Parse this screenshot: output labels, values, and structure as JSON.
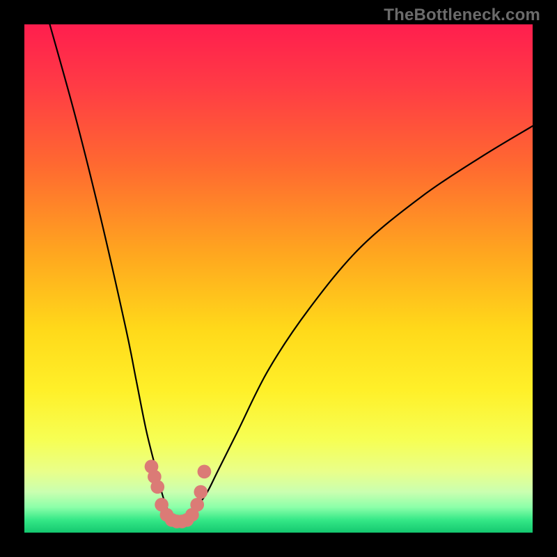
{
  "watermark": "TheBottleneck.com",
  "chart_data": {
    "type": "line",
    "title": "",
    "xlabel": "",
    "ylabel": "",
    "xlim": [
      0,
      100
    ],
    "ylim": [
      0,
      100
    ],
    "series": [
      {
        "name": "bottleneck-curve",
        "x": [
          5,
          10,
          15,
          20,
          22,
          24,
          26,
          27,
          28,
          29,
          30,
          31,
          32,
          33,
          34,
          36,
          38,
          42,
          48,
          56,
          66,
          78,
          90,
          100
        ],
        "y": [
          100,
          82,
          62,
          40,
          30,
          20,
          12,
          8,
          5,
          3,
          2,
          2,
          2,
          3,
          5,
          8,
          12,
          20,
          32,
          44,
          56,
          66,
          74,
          80
        ]
      }
    ],
    "markers": {
      "name": "highlight-dots",
      "color": "#db7b76",
      "x": [
        25.0,
        25.6,
        26.2,
        27.0,
        28.0,
        29.0,
        30.0,
        31.0,
        32.0,
        33.0,
        34.0,
        34.7,
        35.4
      ],
      "y": [
        13.0,
        11.0,
        9.0,
        5.5,
        3.5,
        2.5,
        2.2,
        2.2,
        2.5,
        3.5,
        5.5,
        8.0,
        12.0
      ]
    },
    "background_gradient": {
      "stops": [
        {
          "offset": 0.0,
          "color": "#ff1e4e"
        },
        {
          "offset": 0.12,
          "color": "#ff3b45"
        },
        {
          "offset": 0.28,
          "color": "#ff6a30"
        },
        {
          "offset": 0.45,
          "color": "#ffa61f"
        },
        {
          "offset": 0.6,
          "color": "#ffd91a"
        },
        {
          "offset": 0.72,
          "color": "#fff029"
        },
        {
          "offset": 0.82,
          "color": "#f6ff55"
        },
        {
          "offset": 0.88,
          "color": "#e9ff8a"
        },
        {
          "offset": 0.92,
          "color": "#caffb0"
        },
        {
          "offset": 0.95,
          "color": "#8cffa9"
        },
        {
          "offset": 0.975,
          "color": "#35e887"
        },
        {
          "offset": 1.0,
          "color": "#14c86f"
        }
      ]
    }
  }
}
